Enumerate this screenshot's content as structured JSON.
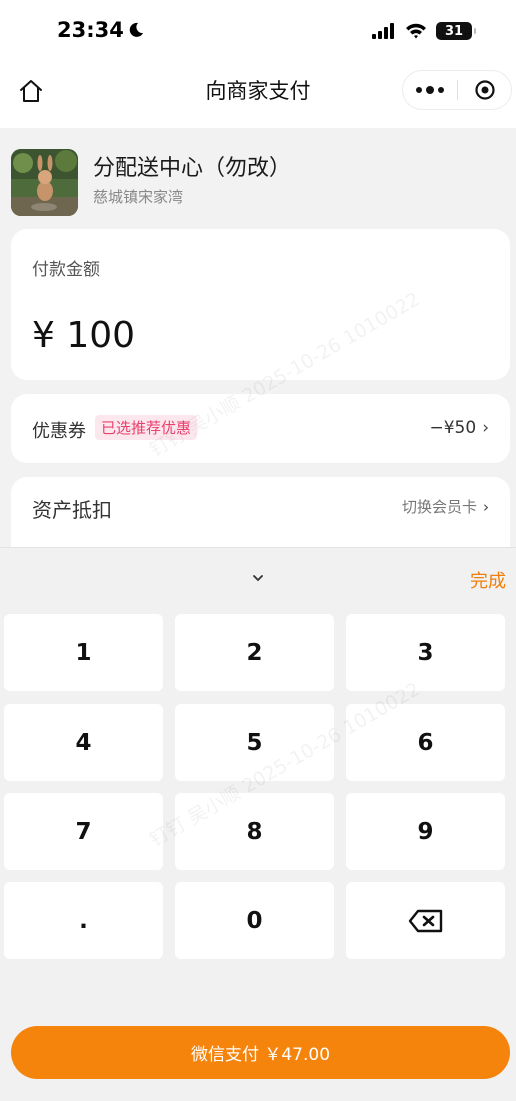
{
  "status_bar": {
    "time": "23:34",
    "battery": "31"
  },
  "nav": {
    "title": "向商家支付"
  },
  "merchant": {
    "name": "分配送中心（勿改）",
    "address": "慈城镇宋家湾"
  },
  "amount": {
    "label": "付款金额",
    "value": "¥ 100"
  },
  "coupon": {
    "label": "优惠券",
    "tag": "已选推荐优惠",
    "value": "−¥50"
  },
  "asset": {
    "label": "资产抵扣",
    "link": "切换会员卡"
  },
  "keyboard": {
    "done": "完成",
    "keys": [
      "1",
      "2",
      "3",
      "4",
      "5",
      "6",
      "7",
      "8",
      "9",
      ".",
      "0"
    ]
  },
  "pay_button": {
    "label": "微信支付 ￥47.00"
  },
  "watermark": [
    "钉钉 吴小顺 2025-10-26 1010022",
    "钉钉 吴小顺 2025-10-26 1010022"
  ],
  "colors": {
    "accent": "#f5840c",
    "done": "#f07e0a",
    "tag_text": "#e8416d",
    "tag_bg": "#fde7ee"
  }
}
